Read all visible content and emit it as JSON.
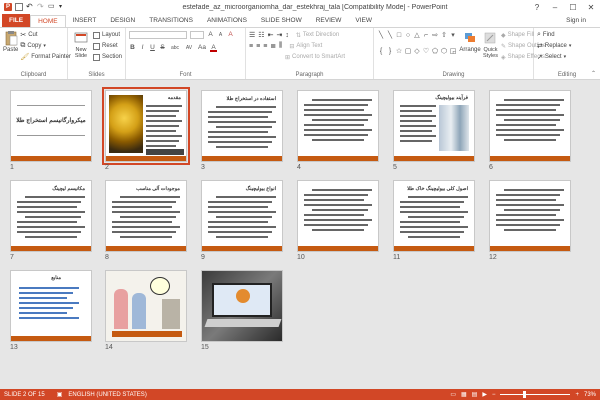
{
  "window": {
    "title": "estefade_az_microorganiomha_dar_estekhraj_tala [Compatibility Mode] - PowerPoint",
    "controls": [
      "?",
      "–",
      "☐",
      "✕"
    ]
  },
  "tabs": {
    "file": "FILE",
    "items": [
      "HOME",
      "INSERT",
      "DESIGN",
      "TRANSITIONS",
      "ANIMATIONS",
      "SLIDE SHOW",
      "REVIEW",
      "VIEW"
    ],
    "active": "HOME",
    "sign_in": "Sign in"
  },
  "ribbon": {
    "clipboard": {
      "label": "Clipboard",
      "paste": "Paste",
      "cut": "Cut",
      "copy": "Copy",
      "format_painter": "Format Painter"
    },
    "slides": {
      "label": "Slides",
      "new_slide": "New Slide",
      "layout": "Layout",
      "reset": "Reset",
      "section": "Section"
    },
    "font": {
      "label": "Font",
      "grow": "A",
      "shrink": "A",
      "clear": "A",
      "bold": "B",
      "italic": "I",
      "underline": "U",
      "strike": "S",
      "shadow": "abc",
      "spacing": "AV",
      "case": "Aa",
      "color": "A"
    },
    "paragraph": {
      "label": "Paragraph",
      "text_direction": "Text Direction",
      "align_text": "Align Text",
      "smartart": "Convert to SmartArt"
    },
    "drawing": {
      "label": "Drawing",
      "arrange": "Arrange",
      "quick_styles": "Quick Styles",
      "shape_fill": "Shape Fill",
      "shape_outline": "Shape Outline",
      "shape_effects": "Shape Effects"
    },
    "editing": {
      "label": "Editing",
      "find": "Find",
      "replace": "Replace",
      "select": "Select"
    }
  },
  "slides": [
    {
      "num": "1",
      "title": "میکروارگانیسم استخراج طلا",
      "kind": "title"
    },
    {
      "num": "2",
      "title": "مقدمه",
      "kind": "gold",
      "selected": true
    },
    {
      "num": "3",
      "title": "استفاده در استخراج طلا",
      "kind": "text"
    },
    {
      "num": "4",
      "title": "",
      "kind": "text"
    },
    {
      "num": "5",
      "title": "فرآیند بیولیچینگ",
      "kind": "photo"
    },
    {
      "num": "6",
      "title": "",
      "kind": "text"
    },
    {
      "num": "7",
      "title": "مکانیسم لیچینگ",
      "kind": "text"
    },
    {
      "num": "8",
      "title": "موجودات آلی مناسب",
      "kind": "text"
    },
    {
      "num": "9",
      "title": "انواع بیولیچینگ",
      "kind": "text"
    },
    {
      "num": "10",
      "title": "",
      "kind": "text"
    },
    {
      "num": "11",
      "title": "اصول کلی بیولیچینگ خاک طلا",
      "kind": "text"
    },
    {
      "num": "12",
      "title": "",
      "kind": "text"
    },
    {
      "num": "13",
      "title": "منابع",
      "kind": "refs"
    },
    {
      "num": "14",
      "title": "",
      "kind": "cartoon"
    },
    {
      "num": "15",
      "title": "",
      "kind": "laptop"
    }
  ],
  "status": {
    "slide_info": "SLIDE 2 OF 15",
    "language": "ENGLISH (UNITED STATES)",
    "zoom": "73%",
    "zoom_value": 73
  },
  "colors": {
    "accent": "#d24726",
    "slide_bar": "#c55a11"
  }
}
